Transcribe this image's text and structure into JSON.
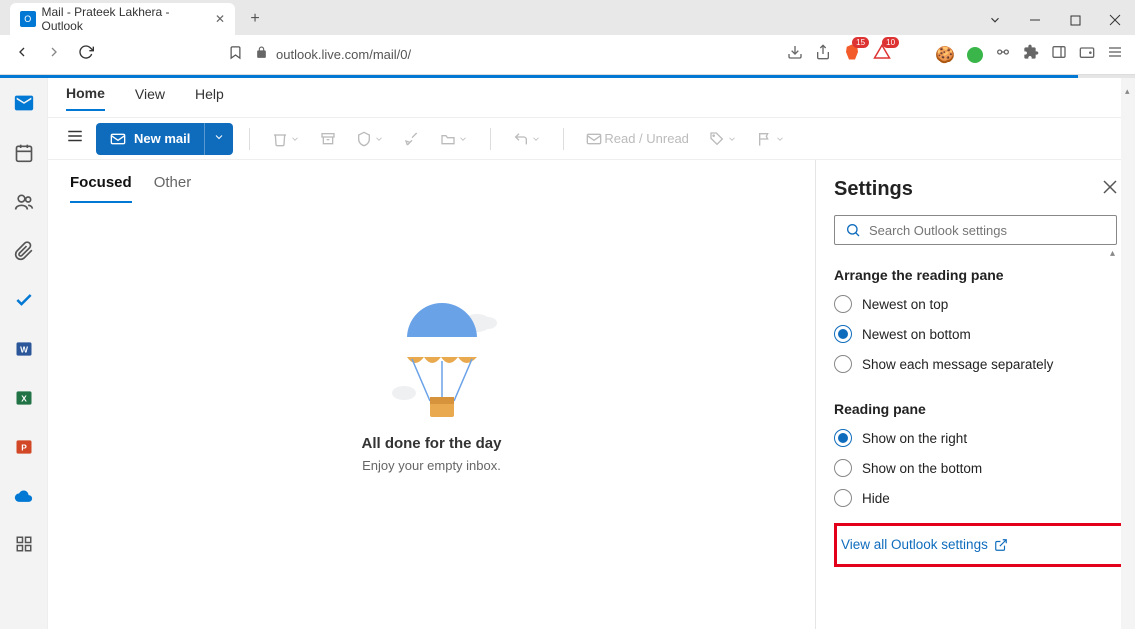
{
  "browser": {
    "tab_title": "Mail - Prateek Lakhera - Outlook",
    "url": "outlook.live.com/mail/0/",
    "brave_badge": "15",
    "triangle_badge": "10"
  },
  "ribbon": {
    "home": "Home",
    "view": "View",
    "help": "Help"
  },
  "toolbar": {
    "new_mail": "New mail",
    "read_unread": "Read / Unread"
  },
  "inbox": {
    "focused": "Focused",
    "other": "Other",
    "empty_title": "All done for the day",
    "empty_sub": "Enjoy your empty inbox."
  },
  "settings": {
    "title": "Settings",
    "search_placeholder": "Search Outlook settings",
    "arrange_label": "Arrange the reading pane",
    "arrange": {
      "newest_top": "Newest on top",
      "newest_bottom": "Newest on bottom",
      "separate": "Show each message separately"
    },
    "reading_label": "Reading pane",
    "reading": {
      "right": "Show on the right",
      "bottom": "Show on the bottom",
      "hide": "Hide"
    },
    "view_all": "View all Outlook settings"
  }
}
